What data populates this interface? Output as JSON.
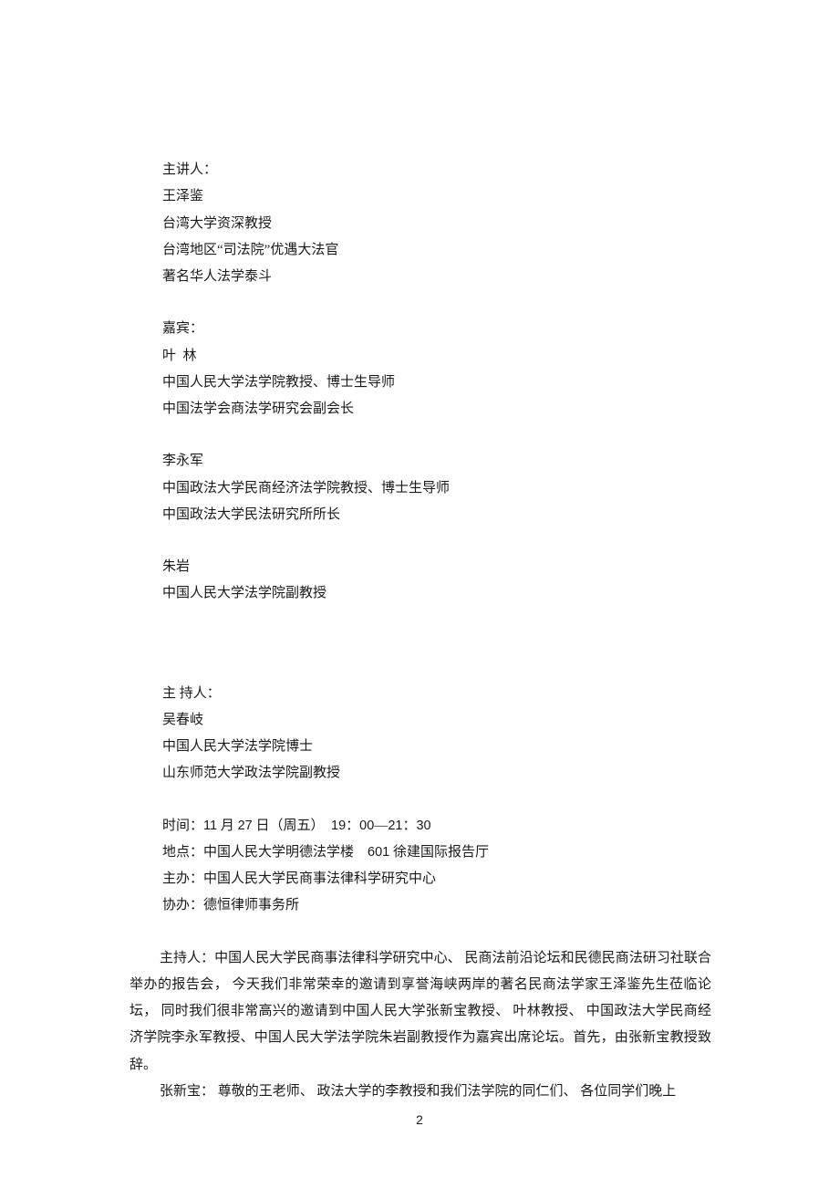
{
  "speaker": {
    "heading": "主讲人：",
    "name": "王泽鉴",
    "title1": "台湾大学资深教授",
    "title2": "台湾地区“司法院”优遇大法官",
    "title3": "著名华人法学泰斗"
  },
  "guests": {
    "heading": "嘉宾：",
    "g1": {
      "name": "叶  林",
      "title1": "中国人民大学法学院教授、博士生导师",
      "title2": "中国法学会商法学研究会副会长"
    },
    "g2": {
      "name": "李永军",
      "title1": "中国政法大学民商经济法学院教授、博士生导师",
      "title2": "中国政法大学民法研究所所长"
    },
    "g3": {
      "name": "朱岩",
      "title1": "中国人民大学法学院副教授"
    }
  },
  "host": {
    "heading": "主 持人：",
    "name": "吴春岐",
    "title1": "中国人民大学法学院博士",
    "title2": "山东师范大学政法学院副教授"
  },
  "info": {
    "time_label": "时",
    "time_sep": "间：",
    "time_date_pre": "11",
    "time_date_mid1": " 月 ",
    "time_date_day": "27",
    "time_date_mid2": " 日（周五）  ",
    "time_t1": "19",
    "time_colon1": "：",
    "time_t2": "00",
    "time_dash": "—",
    "time_t3": "21",
    "time_colon2": "：",
    "time_t4": "30",
    "place_label": "地",
    "place_sep": "点：",
    "place_v1": "中国人民大学明德法学楼    ",
    "place_num": "601",
    "place_v2": " 徐建国际报告厅",
    "org_label": "主",
    "org_sep": "办：",
    "org_value": "中国人民大学民商事法律科学研究中心",
    "co_label": "协",
    "co_sep": "办：",
    "co_value": "德恒律师事务所"
  },
  "body": {
    "p1": "主持人：中国人民大学民商事法律科学研究中心、    民商法前沿论坛和民德民商法研习社联合举办的报告会，   今天我们非常荣幸的邀请到享誉海峡两岸的著名民商法学家王泽鉴先生莅临论坛，   同时我们很非常高兴的邀请到中国人民大学张新宝教授、     叶林教授、  中国政法大学民商经济学院李永军教授、中国人民大学法学院朱岩副教授作为嘉宾出席论坛。首先，由张新宝教授致辞。",
    "p2": "张新宝：  尊敬的王老师、   政法大学的李教授和我们法学院的同仁们、      各位同学们晚上"
  },
  "page_number": "2"
}
